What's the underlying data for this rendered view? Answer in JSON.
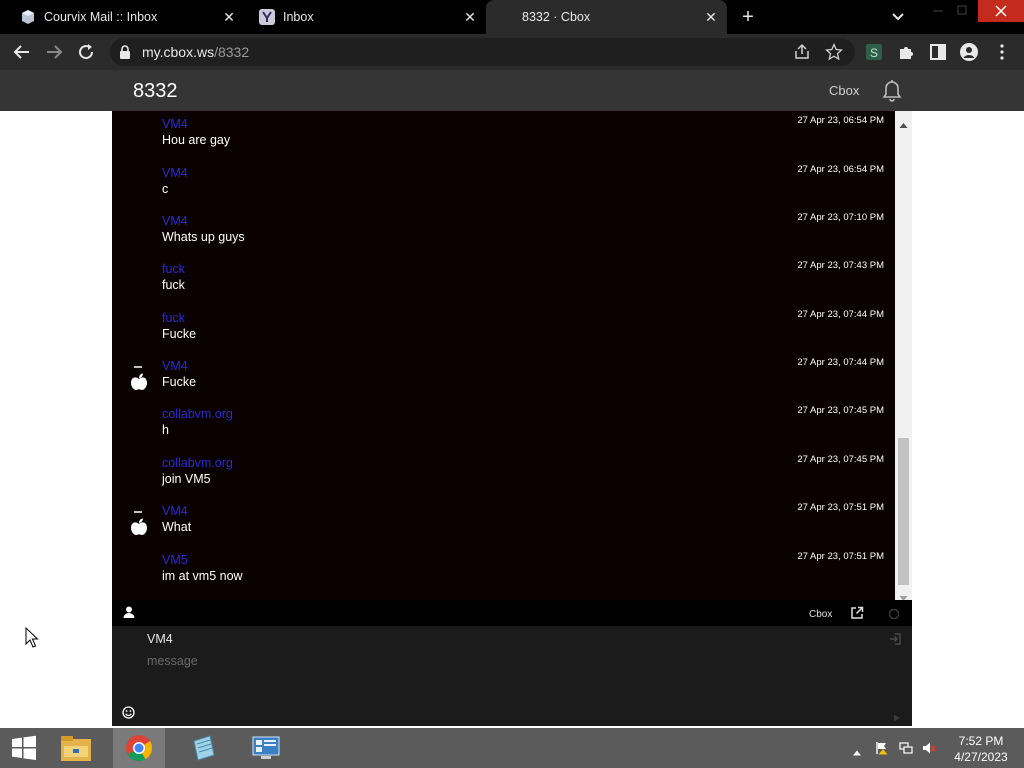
{
  "browser": {
    "tabs": [
      {
        "title": "Courvix Mail :: Inbox",
        "active": false
      },
      {
        "title": "Inbox",
        "active": false
      },
      {
        "title": "8332 · Cbox",
        "active": true
      }
    ],
    "url": {
      "host": "my.cbox.ws",
      "path": "/8332"
    }
  },
  "cbox": {
    "title": "8332",
    "brand": "Cbox",
    "footer_brand": "Cbox",
    "messages": [
      {
        "nick": "VM4",
        "text": "Hou are gay",
        "time": "27 Apr 23, 06:54 PM",
        "avatar": false
      },
      {
        "nick": "VM4",
        "text": "c",
        "time": "27 Apr 23, 06:54 PM",
        "avatar": false
      },
      {
        "nick": "VM4",
        "text": "Whats up guys",
        "time": "27 Apr 23, 07:10 PM",
        "avatar": false
      },
      {
        "nick": "fuck",
        "text": "fuck",
        "time": "27 Apr 23, 07:43 PM",
        "avatar": false
      },
      {
        "nick": "fuck",
        "text": "Fucke",
        "time": "27 Apr 23, 07:44 PM",
        "avatar": false
      },
      {
        "nick": "VM4",
        "text": "Fucke",
        "time": "27 Apr 23, 07:44 PM",
        "avatar": true
      },
      {
        "nick": "collabvm.org",
        "text": "h",
        "time": "27 Apr 23, 07:45 PM",
        "avatar": false
      },
      {
        "nick": "collabvm.org",
        "text": "join VM5",
        "time": "27 Apr 23, 07:45 PM",
        "avatar": false
      },
      {
        "nick": "VM4",
        "text": "What",
        "time": "27 Apr 23, 07:51 PM",
        "avatar": true
      },
      {
        "nick": "VM5",
        "text": "im at vm5 now",
        "time": "27 Apr 23, 07:51 PM",
        "avatar": false
      }
    ],
    "input": {
      "nick_value": "VM4",
      "message_placeholder": "message"
    }
  },
  "taskbar": {
    "time": "7:52 PM",
    "date": "4/27/2023",
    "apps": [
      "file-explorer-icon",
      "chrome-icon",
      "notepad-icon",
      "control-panel-icon"
    ]
  },
  "colors": {
    "nick": "#2b2bd6",
    "chat_bg": "#0a0000",
    "header_bg": "#353535"
  }
}
